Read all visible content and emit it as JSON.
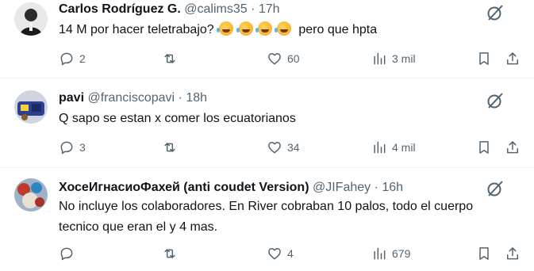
{
  "replies": [
    {
      "name": "Carlos Rodríguez G.",
      "handle": "@calims35",
      "separator": "·",
      "time": "17h",
      "text_before_emoji": "14 M por hacer teletrabajo?",
      "emoji_count": 4,
      "emoji_icon": "rolling-on-floor-laughing-emoji",
      "text_after_emoji": " pero que hpta",
      "replies_count": "2",
      "reposts_count": "",
      "likes_count": "60",
      "views_count": "3 mil"
    },
    {
      "name": "pavi",
      "handle": "@franciscopavi",
      "separator": "·",
      "time": "18h",
      "text": "Q sapo se estan x comer los ecuatorianos",
      "replies_count": "3",
      "reposts_count": "",
      "likes_count": "34",
      "views_count": "4 mil"
    },
    {
      "name": "ХосеИгнасиоФахей (anti coudet Version)",
      "handle": "@JIFahey",
      "separator": "·",
      "time": "16h",
      "text": "No incluye los colaboradores. En River cobraban 10 palos, todo el cuerpo tecnico que eran el y 4 mas.",
      "replies_count": "",
      "reposts_count": "",
      "likes_count": "4",
      "views_count": "679"
    }
  ],
  "colors": {
    "text_primary": "#0f1419",
    "text_secondary": "#536471",
    "divider": "#eff3f4"
  },
  "icons": [
    "grok-icon",
    "reply-icon",
    "repost-icon",
    "like-icon",
    "views-icon",
    "bookmark-icon",
    "share-icon"
  ]
}
